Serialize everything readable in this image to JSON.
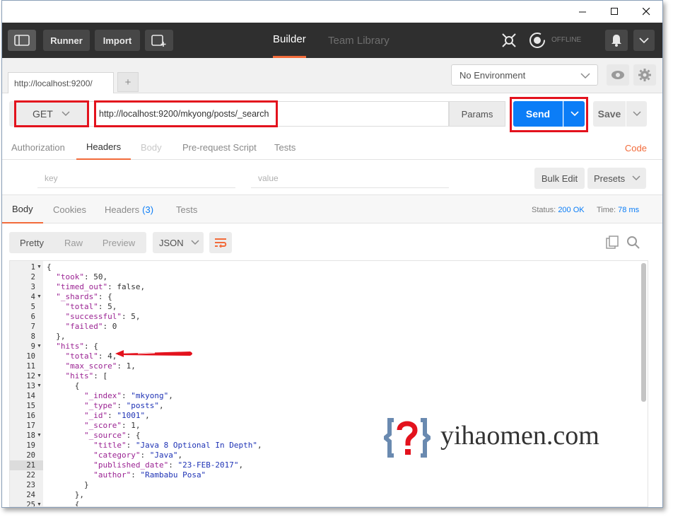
{
  "window": {
    "minimize_icon": "minimize-icon",
    "maximize_icon": "maximize-icon",
    "close_icon": "close-icon"
  },
  "toolbar": {
    "runner": "Runner",
    "import": "Import",
    "builder": "Builder",
    "team_library": "Team Library",
    "offline": "OFFLINE"
  },
  "tabs": {
    "request_tab": "http://localhost:9200/",
    "add_tab": "+"
  },
  "environment": {
    "selected": "No Environment"
  },
  "request": {
    "method": "GET",
    "url": "http://localhost:9200/mkyong/posts/_search",
    "params": "Params",
    "send": "Send",
    "save": "Save"
  },
  "request_tabs": {
    "authorization": "Authorization",
    "headers": "Headers",
    "body": "Body",
    "pre_request": "Pre-request Script",
    "tests": "Tests",
    "code": "Code"
  },
  "headers_editor": {
    "key_placeholder": "key",
    "value_placeholder": "value",
    "bulk_edit": "Bulk Edit",
    "presets": "Presets"
  },
  "response_tabs": {
    "body": "Body",
    "cookies": "Cookies",
    "headers": "Headers",
    "headers_count": "(3)",
    "tests": "Tests",
    "status_label": "Status:",
    "status_value": "200 OK",
    "time_label": "Time:",
    "time_value": "78 ms"
  },
  "body_toolbar": {
    "pretty": "Pretty",
    "raw": "Raw",
    "preview": "Preview",
    "format": "JSON"
  },
  "code_lines": [
    {
      "n": "1",
      "fold": true,
      "text": "{"
    },
    {
      "n": "2",
      "text": "  \"took\": 50,"
    },
    {
      "n": "3",
      "text": "  \"timed_out\": false,"
    },
    {
      "n": "4",
      "fold": true,
      "text": "  \"_shards\": {"
    },
    {
      "n": "5",
      "text": "    \"total\": 5,"
    },
    {
      "n": "6",
      "text": "    \"successful\": 5,"
    },
    {
      "n": "7",
      "text": "    \"failed\": 0"
    },
    {
      "n": "8",
      "text": "  },"
    },
    {
      "n": "9",
      "fold": true,
      "text": "  \"hits\": {"
    },
    {
      "n": "10",
      "text": "    \"total\": 4,"
    },
    {
      "n": "11",
      "text": "    \"max_score\": 1,"
    },
    {
      "n": "12",
      "fold": true,
      "text": "    \"hits\": ["
    },
    {
      "n": "13",
      "fold": true,
      "text": "      {"
    },
    {
      "n": "14",
      "text": "        \"_index\": \"mkyong\","
    },
    {
      "n": "15",
      "text": "        \"_type\": \"posts\","
    },
    {
      "n": "16",
      "text": "        \"_id\": \"1001\","
    },
    {
      "n": "17",
      "text": "        \"_score\": 1,"
    },
    {
      "n": "18",
      "fold": true,
      "text": "        \"_source\": {"
    },
    {
      "n": "19",
      "text": "          \"title\": \"Java 8 Optional In Depth\","
    },
    {
      "n": "20",
      "text": "          \"category\": \"Java\","
    },
    {
      "n": "21",
      "text": "          \"published_date\": \"23-FEB-2017\","
    },
    {
      "n": "22",
      "text": "          \"author\": \"Rambabu Posa\""
    },
    {
      "n": "23",
      "text": "        }"
    },
    {
      "n": "24",
      "text": "      },"
    },
    {
      "n": "25",
      "fold": true,
      "text": "      {"
    }
  ],
  "watermark": {
    "text": "yihaomen.com"
  },
  "colors": {
    "accent_orange": "#f26b3a",
    "send_blue": "#0b7df7",
    "highlight_red": "#e3121d",
    "toolbar_dark": "#2f2f2f"
  }
}
